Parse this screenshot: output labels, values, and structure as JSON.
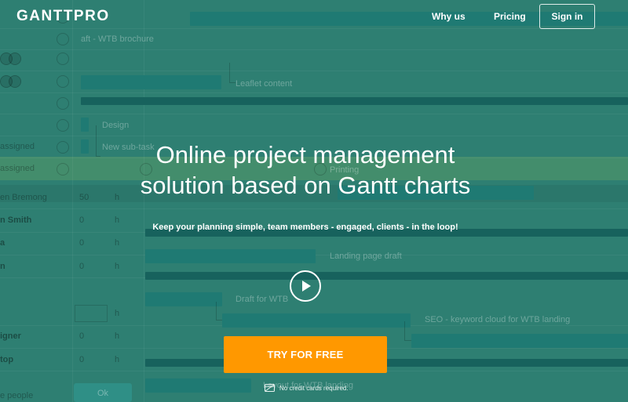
{
  "header": {
    "logo": "GANTTPRO",
    "nav": {
      "why_us": "Why us",
      "pricing": "Pricing"
    },
    "sign_in": "Sign in"
  },
  "hero": {
    "title_line1": "Online project management",
    "title_line2": "solution based on Gantt charts",
    "subtitle": "Keep your planning simple, team members - engaged, clients - in the loop!",
    "cta": "TRY FOR FREE",
    "no_card": "No credit cards required."
  },
  "background": {
    "tasks": [
      "aft - WTB brochure",
      "Leaflet content",
      "Design",
      "New sub-task",
      "Printing",
      "Landing page draft",
      "Draft for WTB",
      "SEO - keyword cloud for WTB landing",
      "Layout for WTB landing"
    ],
    "assign_1": "assigned",
    "assign_2": "assigned",
    "people": [
      "en Bremong",
      "n Smith",
      "a",
      "n",
      "igner",
      "top"
    ],
    "hours": [
      "50",
      "0",
      "0",
      "0",
      "0",
      "0"
    ],
    "hour_unit": "h",
    "add_people": "e people",
    "ok": "Ok"
  },
  "colors": {
    "overlay": "#2e7f72",
    "cta": "#ff9800",
    "gantt_bar": "#1f7a73"
  }
}
